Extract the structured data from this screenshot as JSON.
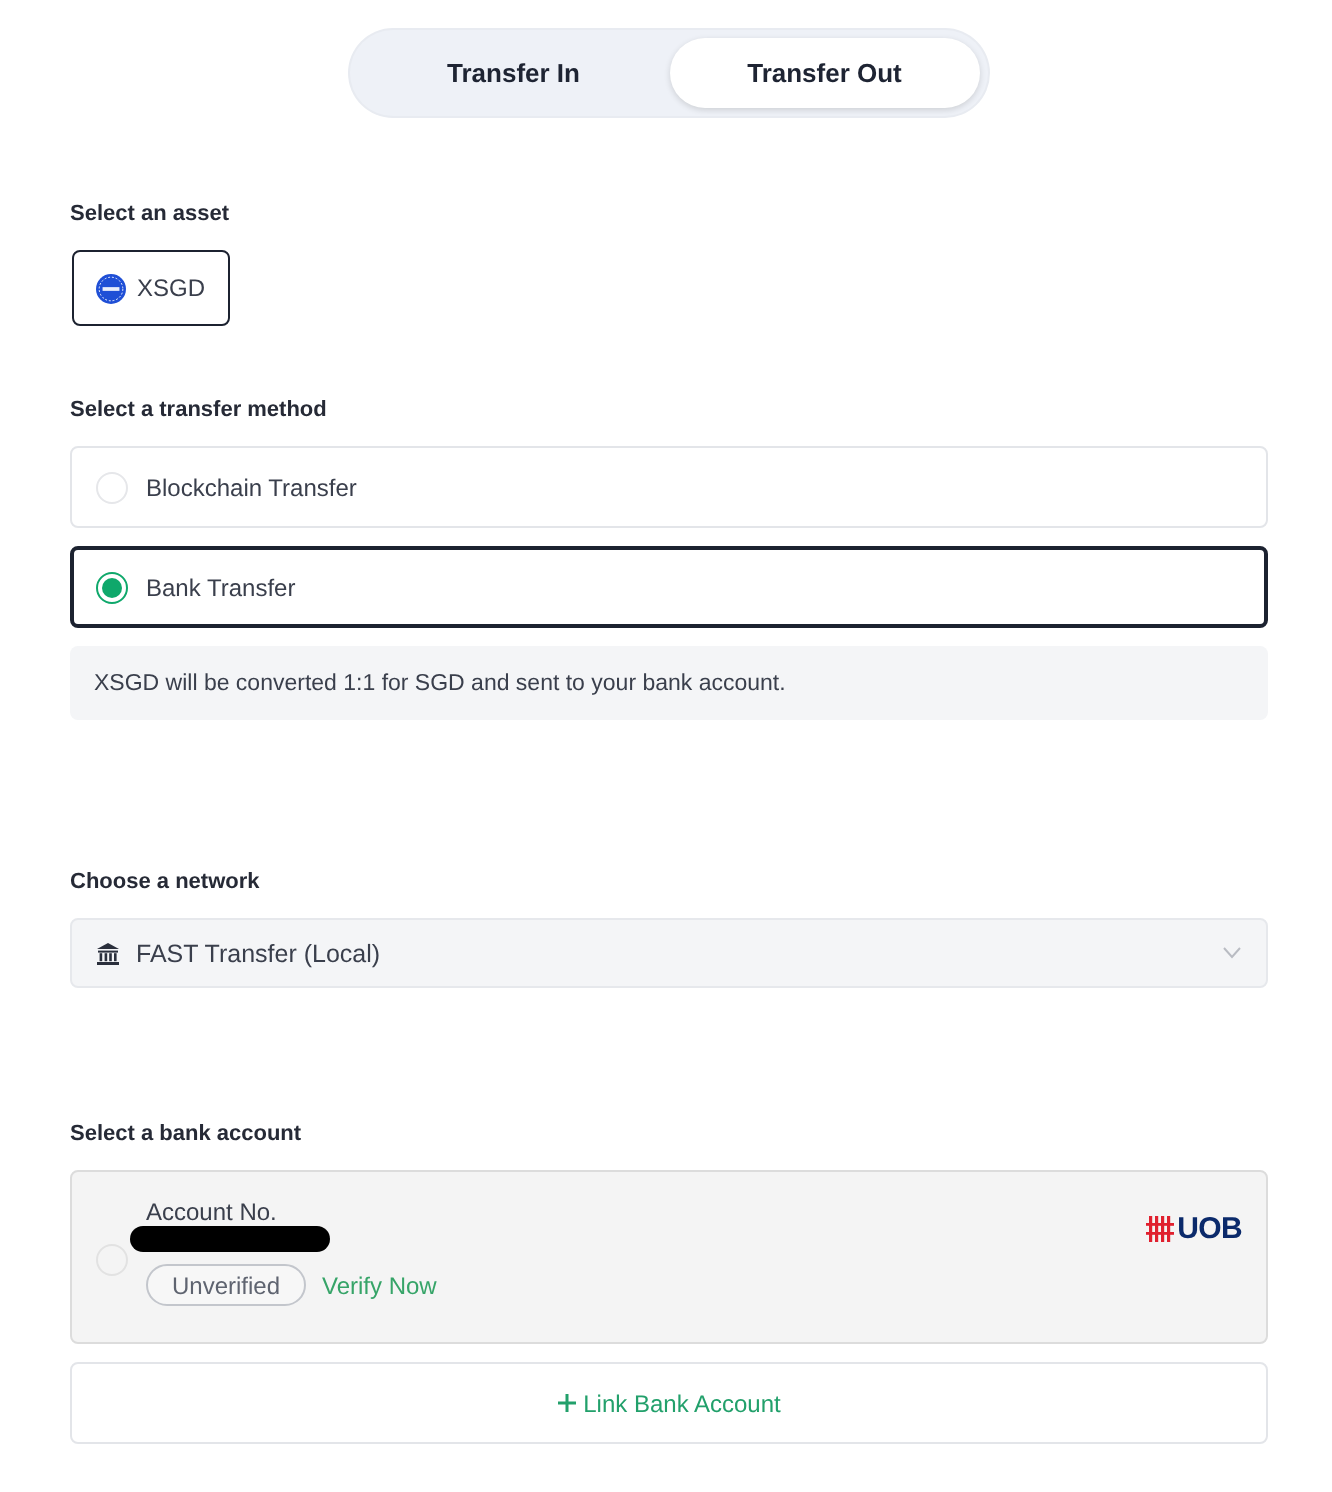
{
  "toggle": [
    {
      "label": "Transfer In",
      "selected": false
    },
    {
      "label": "Transfer Out",
      "selected": true
    }
  ],
  "asset_section": {
    "label": "Select an asset",
    "assets": [
      {
        "symbol": "XSGD",
        "selected": true
      }
    ]
  },
  "method_section": {
    "label": "Select a transfer method",
    "methods": [
      {
        "label": "Blockchain Transfer",
        "selected": false
      },
      {
        "label": "Bank Transfer",
        "selected": true
      }
    ],
    "note": "XSGD will be converted 1:1 for SGD and sent to your bank account."
  },
  "network_section": {
    "label": "Choose a network",
    "select": {
      "value": "FAST Transfer (Local)"
    }
  },
  "bank_section": {
    "label": "Select a bank account",
    "accounts": [
      {
        "title": "Account No.",
        "selected": false,
        "status": "Unverified",
        "action": "Verify Now",
        "bank": "UOB"
      }
    ],
    "link_button": "Link Bank Account"
  }
}
